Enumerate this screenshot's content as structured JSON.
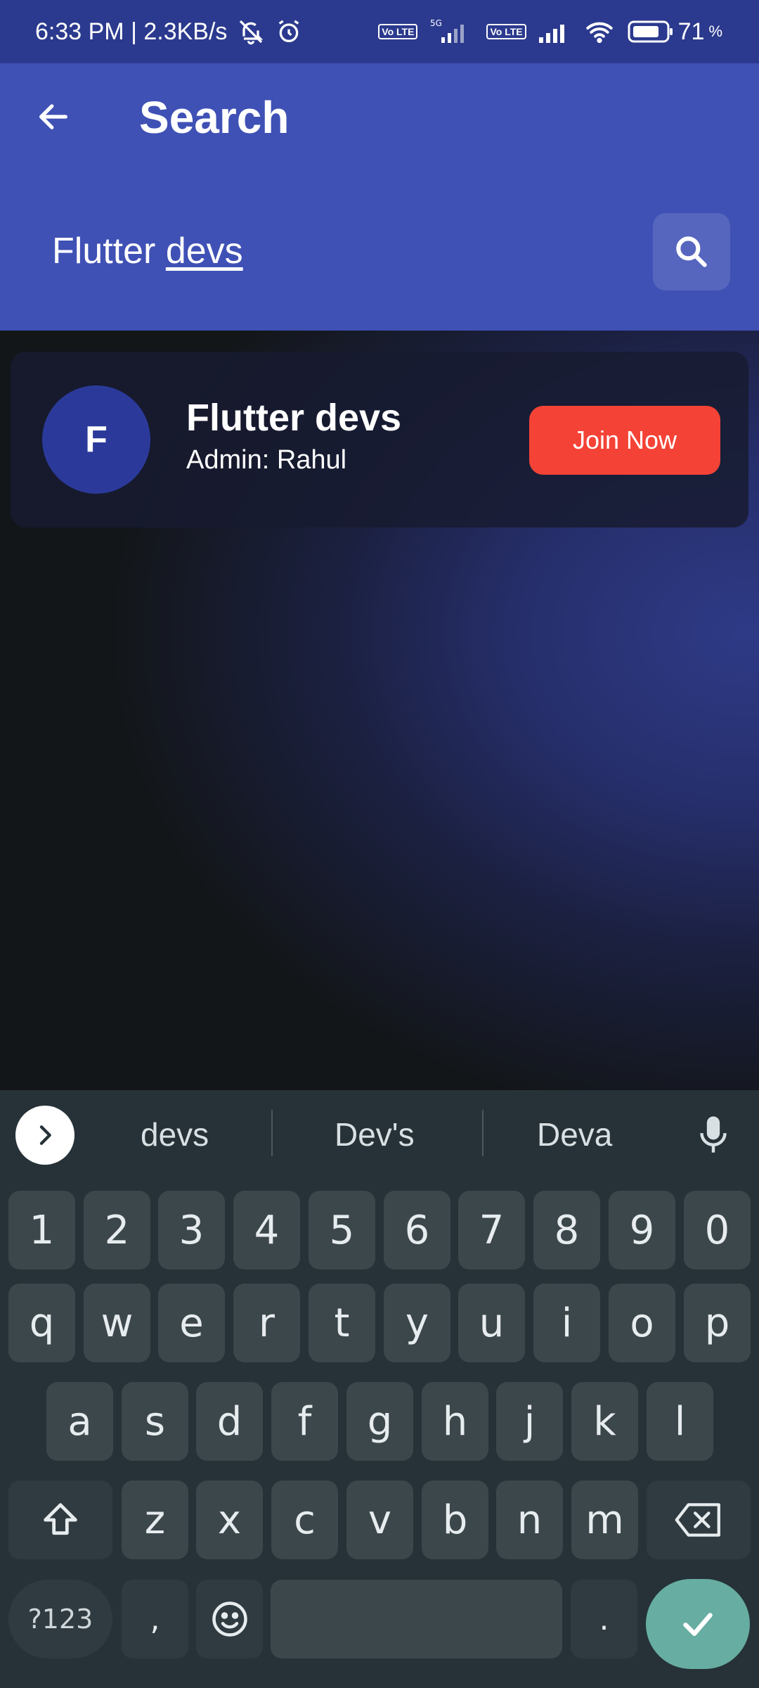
{
  "status_bar": {
    "time_speed": "6:33 PM | 2.3KB/s",
    "volte_1": "Vo LTE",
    "network_5g": "5G",
    "volte_2": "Vo LTE",
    "battery": "71",
    "battery_unit": "%"
  },
  "app_bar": {
    "title": "Search",
    "search": {
      "value_prefix": "Flutter ",
      "value_underlined": "devs",
      "value": "Flutter devs"
    },
    "color": "#3f51b5"
  },
  "results": [
    {
      "avatar_letter": "F",
      "name": "Flutter devs",
      "admin": "Admin: Rahul",
      "action_label": "Join Now"
    }
  ],
  "keyboard": {
    "suggestions": [
      "devs",
      "Dev's",
      "Deva"
    ],
    "rows": {
      "numbers": [
        "1",
        "2",
        "3",
        "4",
        "5",
        "6",
        "7",
        "8",
        "9",
        "0"
      ],
      "row1": [
        "q",
        "w",
        "e",
        "r",
        "t",
        "y",
        "u",
        "i",
        "o",
        "p"
      ],
      "row2": [
        "a",
        "s",
        "d",
        "f",
        "g",
        "h",
        "j",
        "k",
        "l"
      ],
      "row3": [
        "z",
        "x",
        "c",
        "v",
        "b",
        "n",
        "m"
      ]
    },
    "symbols_label": "?123",
    "comma": ",",
    "period": ".",
    "accent_color": "#67ada2"
  },
  "colors": {
    "join_button": "#f44336",
    "avatar_bg": "#2b3a9a",
    "keyboard_bg": "#263237"
  }
}
